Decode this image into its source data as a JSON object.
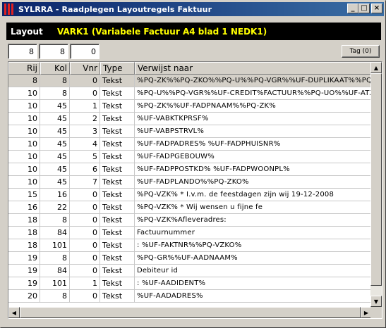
{
  "window": {
    "title": "SYLRRA - Raadplegen Layoutregels Faktuur",
    "minimize": "_",
    "maximize": "□",
    "close": "×"
  },
  "layout_bar": {
    "label": "Layout",
    "value": "VARK1  (Variabele Factuur A4 blad 1 NEDK1)"
  },
  "fields": [
    "8",
    "8",
    "0"
  ],
  "tag_button": "Tag (0)",
  "grid": {
    "columns": [
      "Rij",
      "Kol",
      "Vnr",
      "Type",
      "Verwijst naar"
    ],
    "rows": [
      {
        "rij": "8",
        "kol": "8",
        "vnr": "0",
        "type": "Tekst",
        "ref": "%PQ-ZK%%PQ-ZKO%%PQ-U%%PQ-VGR%%UF-DUPLIKAAT%%PQ-V"
      },
      {
        "rij": "10",
        "kol": "8",
        "vnr": "0",
        "type": "Tekst",
        "ref": "%PQ-U%%PQ-VGR%%UF-CREDIT%FACTUUR%%PQ-UO%%UF-ATXT%"
      },
      {
        "rij": "10",
        "kol": "45",
        "vnr": "1",
        "type": "Tekst",
        "ref": "%PQ-ZK%%UF-FADPNAAM%%PQ-ZK%"
      },
      {
        "rij": "10",
        "kol": "45",
        "vnr": "2",
        "type": "Tekst",
        "ref": "%UF-VABKTKPRSF%"
      },
      {
        "rij": "10",
        "kol": "45",
        "vnr": "3",
        "type": "Tekst",
        "ref": "%UF-VABPSTRVL%"
      },
      {
        "rij": "10",
        "kol": "45",
        "vnr": "4",
        "type": "Tekst",
        "ref": "%UF-FADPADRES% %UF-FADPHUISNR%"
      },
      {
        "rij": "10",
        "kol": "45",
        "vnr": "5",
        "type": "Tekst",
        "ref": "%UF-FADPGEBOUW%"
      },
      {
        "rij": "10",
        "kol": "45",
        "vnr": "6",
        "type": "Tekst",
        "ref": "%UF-FADPPOSTKD%  %UF-FADPWOONPL%"
      },
      {
        "rij": "10",
        "kol": "45",
        "vnr": "7",
        "type": "Tekst",
        "ref": "%UF-FADPLANDO%%PQ-ZKO%"
      },
      {
        "rij": "15",
        "kol": "16",
        "vnr": "0",
        "type": "Tekst",
        "ref": "%PQ-VZK% * I.v.m. de feestdagen zijn wij 19-12-2008"
      },
      {
        "rij": "16",
        "kol": "22",
        "vnr": "0",
        "type": "Tekst",
        "ref": "%PQ-VZK%                    * Wij wensen u fijne fe"
      },
      {
        "rij": "18",
        "kol": "8",
        "vnr": "0",
        "type": "Tekst",
        "ref": "%PQ-VZK%Afleveradres:"
      },
      {
        "rij": "18",
        "kol": "84",
        "vnr": "0",
        "type": "Tekst",
        "ref": "Factuurnummer"
      },
      {
        "rij": "18",
        "kol": "101",
        "vnr": "0",
        "type": "Tekst",
        "ref": ": %UF-FAKTNR%%PQ-VZKO%"
      },
      {
        "rij": "19",
        "kol": "8",
        "vnr": "0",
        "type": "Tekst",
        "ref": "%PQ-GR%%UF-AADNAAM%"
      },
      {
        "rij": "19",
        "kol": "84",
        "vnr": "0",
        "type": "Tekst",
        "ref": "Debiteur id"
      },
      {
        "rij": "19",
        "kol": "101",
        "vnr": "1",
        "type": "Tekst",
        "ref": ": %UF-AADIDENT%"
      },
      {
        "rij": "20",
        "kol": "8",
        "vnr": "0",
        "type": "Tekst",
        "ref": "%UF-AADADRES%"
      }
    ]
  }
}
